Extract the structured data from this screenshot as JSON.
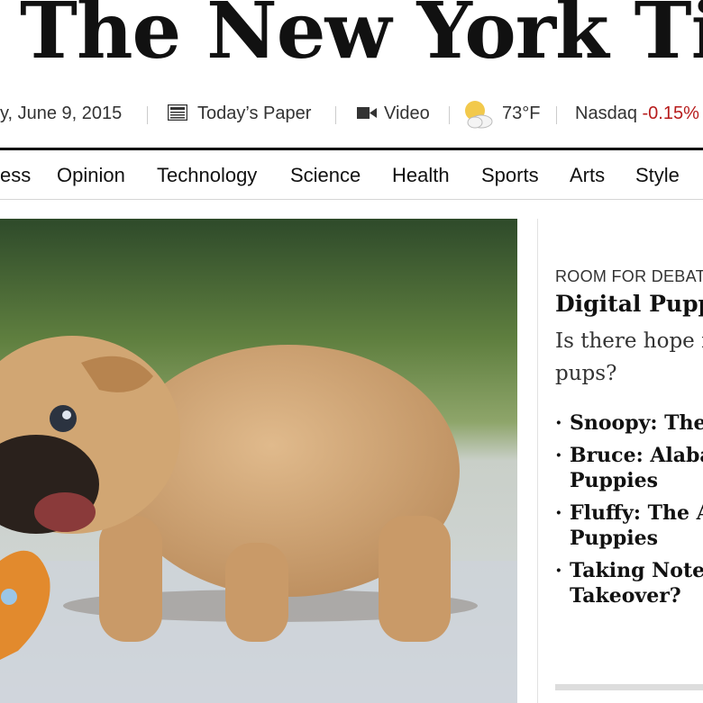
{
  "masthead": {
    "title": "The New York Times"
  },
  "utility_bar": {
    "date": "y, June 9, 2015",
    "todays_paper": "Today’s Paper",
    "video": "Video",
    "weather": "73°F",
    "market_name": "Nasdaq",
    "market_change": "-0.15%"
  },
  "nav": {
    "items": [
      "ess",
      "Opinion",
      "Technology",
      "Science",
      "Health",
      "Sports",
      "Arts",
      "Style"
    ]
  },
  "room_for_debate": {
    "kicker": "ROOM FOR DEBAT",
    "headline": "Digital Puppy",
    "summary": "Is there hope f pups?",
    "items": [
      "Snoopy: The I",
      "Bruce: Alabar Puppies",
      "Fluffy: The Ar Puppies",
      "Taking Note: . Takeover?"
    ]
  },
  "colors": {
    "market_down": "#b71c1c",
    "text": "#333333",
    "masthead": "#111111"
  },
  "icons": {
    "paper": "newspaper-icon",
    "video": "video-camera-icon",
    "weather": "partly-cloudy-icon"
  }
}
